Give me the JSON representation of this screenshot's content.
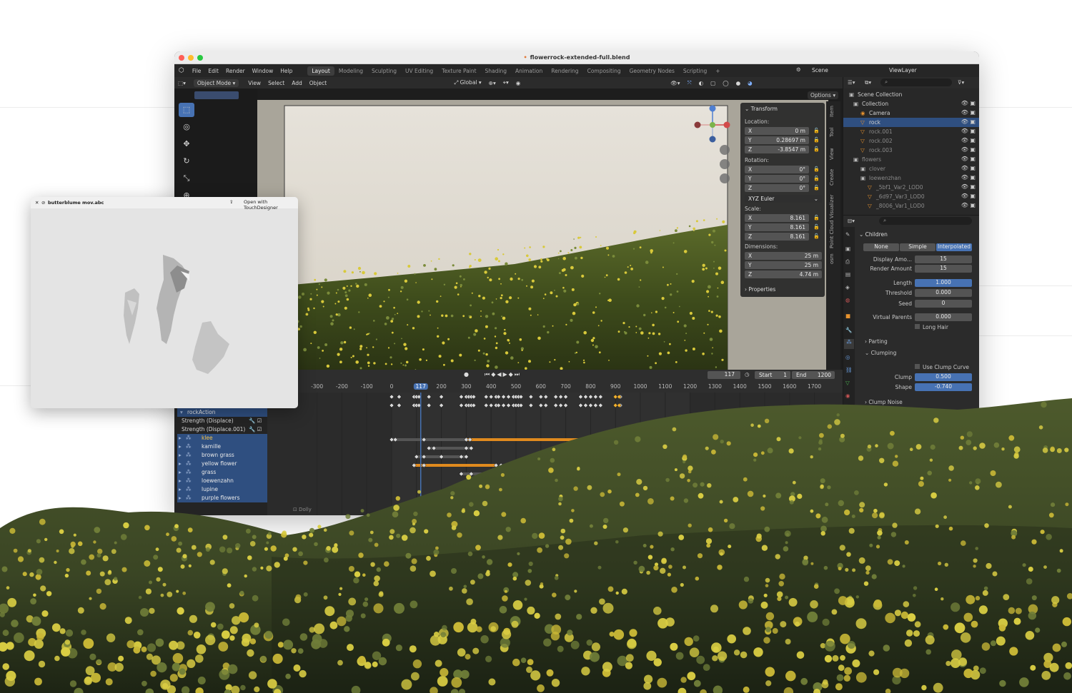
{
  "window": {
    "title": "flowerrock-extended-full.blend",
    "menu": [
      "File",
      "Edit",
      "Render",
      "Window",
      "Help"
    ],
    "workspaces": [
      "Layout",
      "Modeling",
      "Sculpting",
      "UV Editing",
      "Texture Paint",
      "Shading",
      "Animation",
      "Rendering",
      "Compositing",
      "Geometry Nodes",
      "Scripting"
    ],
    "active_workspace": "Layout",
    "add_workspace": "+",
    "scene": "Scene",
    "view_layer": "ViewLayer"
  },
  "header": {
    "mode": "Object Mode",
    "menus": [
      "View",
      "Select",
      "Add",
      "Object"
    ],
    "transform_orientation": "Global",
    "options": "Options"
  },
  "n_panel": {
    "tabs": [
      "Item",
      "Tool",
      "View",
      "Create",
      "Point Cloud Visualizer",
      "osm"
    ],
    "transform_title": "Transform",
    "location_label": "Location:",
    "location": [
      {
        "axis": "X",
        "value": "0 m"
      },
      {
        "axis": "Y",
        "value": "0.28697 m"
      },
      {
        "axis": "Z",
        "value": "-3.8547 m"
      }
    ],
    "rotation_label": "Rotation:",
    "rotation": [
      {
        "axis": "X",
        "value": "0°"
      },
      {
        "axis": "Y",
        "value": "0°"
      },
      {
        "axis": "Z",
        "value": "0°"
      }
    ],
    "rotation_mode": "XYZ Euler",
    "scale_label": "Scale:",
    "scale": [
      {
        "axis": "X",
        "value": "8.161"
      },
      {
        "axis": "Y",
        "value": "8.161"
      },
      {
        "axis": "Z",
        "value": "8.161"
      }
    ],
    "dimensions_label": "Dimensions:",
    "dimensions": [
      {
        "axis": "X",
        "value": "25 m"
      },
      {
        "axis": "Y",
        "value": "25 m"
      },
      {
        "axis": "Z",
        "value": "4.74 m"
      }
    ],
    "properties_title": "Properties"
  },
  "outliner": {
    "scene_collection": "Scene Collection",
    "items": [
      {
        "name": "Collection",
        "selected": false
      },
      {
        "name": "Camera",
        "selected": false
      },
      {
        "name": "rock",
        "selected": true
      },
      {
        "name": "rock.001",
        "selected": false
      },
      {
        "name": "rock.002",
        "selected": false
      },
      {
        "name": "rock.003",
        "selected": false
      },
      {
        "name": "flowers",
        "selected": false
      },
      {
        "name": "clover",
        "selected": false
      },
      {
        "name": "loewenzhan",
        "selected": false
      },
      {
        "name": "_5bf1_Var2_LOD0",
        "selected": false
      },
      {
        "name": "_6d97_Var3_LOD0",
        "selected": false
      },
      {
        "name": "_8006_Var1_LOD0",
        "selected": false
      }
    ]
  },
  "properties": {
    "children_title": "Children",
    "child_modes": [
      "None",
      "Simple",
      "Interpolated"
    ],
    "active_child_mode": "Interpolated",
    "display_amount_label": "Display Amo...",
    "display_amount": "15",
    "render_amount_label": "Render Amount",
    "render_amount": "15",
    "length_label": "Length",
    "length": "1.000",
    "threshold_label": "Threshold",
    "threshold": "0.000",
    "seed_label": "Seed",
    "seed": "0",
    "virtual_parents_label": "Virtual Parents",
    "virtual_parents": "0.000",
    "long_hair": "Long Hair",
    "parting": "Parting",
    "clumping": "Clumping",
    "use_clump_curve": "Use Clump Curve",
    "clump_label": "Clump",
    "clump": "0.500",
    "shape_label": "Shape",
    "shape": "-0.740",
    "clump_noise": "Clump Noise"
  },
  "timeline": {
    "current_frame": "117",
    "start_label": "Start",
    "start": "1",
    "end_label": "End",
    "end": "1200",
    "ruler": [
      "-300",
      "-200",
      "-100",
      "0",
      "117",
      "200",
      "300",
      "400",
      "500",
      "600",
      "700",
      "800",
      "900",
      "1000",
      "1100",
      "1200",
      "1300",
      "1400",
      "1500",
      "1600",
      "1700"
    ],
    "action": "rockAction",
    "channels": [
      {
        "name": "Strength (Displace)",
        "selected": false,
        "highlight": false
      },
      {
        "name": "Strength (Displace.001)",
        "selected": false,
        "highlight": false
      },
      {
        "name": "klee",
        "selected": true,
        "highlight": true
      },
      {
        "name": "kamille",
        "selected": true,
        "highlight": false
      },
      {
        "name": "brown grass",
        "selected": true,
        "highlight": false
      },
      {
        "name": "yellow flower",
        "selected": true,
        "highlight": false
      },
      {
        "name": "grass",
        "selected": true,
        "highlight": false
      },
      {
        "name": "loewenzahn",
        "selected": true,
        "highlight": false
      },
      {
        "name": "lupine",
        "selected": true,
        "highlight": false
      },
      {
        "name": "purple flowers",
        "selected": true,
        "highlight": false
      }
    ],
    "footer_label": "Dolly"
  },
  "player": {
    "filename": "butterblume mov.abc",
    "open_with": "Open with TouchDesigner"
  },
  "colors": {
    "accent_blue": "#4772b3",
    "selection_blue": "#2f4f80",
    "keyframe_orange": "#e08a1e",
    "flower_yellow": "#d8c93a"
  }
}
